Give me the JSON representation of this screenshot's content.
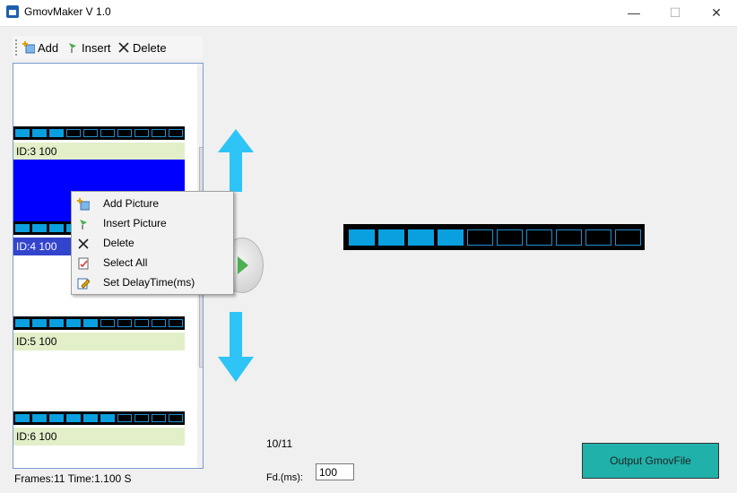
{
  "window": {
    "title": "GmovMaker V 1.0",
    "minimize_glyph": "—",
    "maximize_glyph": "☐",
    "close_glyph": "✕"
  },
  "toolbar": {
    "add_label": "Add",
    "insert_label": "Insert",
    "delete_label": "Delete"
  },
  "frames": [
    {
      "label": "ID:3  100",
      "cells": [
        1,
        1,
        1,
        0,
        0,
        0,
        0,
        0,
        0,
        0
      ],
      "selected": false
    },
    {
      "label": "ID:4  100",
      "cells": [
        1,
        1,
        1,
        1,
        0,
        0,
        0,
        0,
        0,
        0
      ],
      "selected": true
    },
    {
      "label": "ID:5  100",
      "cells": [
        1,
        1,
        1,
        1,
        1,
        0,
        0,
        0,
        0,
        0
      ],
      "selected": false
    },
    {
      "label": "ID:6  100",
      "cells": [
        1,
        1,
        1,
        1,
        1,
        1,
        0,
        0,
        0,
        0
      ],
      "selected": false
    }
  ],
  "context_menu": {
    "items": [
      {
        "label": "Add Picture",
        "icon": "add-picture-icon"
      },
      {
        "label": "Insert Picture",
        "icon": "insert-flag-icon"
      },
      {
        "label": "Delete",
        "icon": "delete-x-icon"
      },
      {
        "label": "Select All",
        "icon": "select-all-icon"
      },
      {
        "label": "Set DelayTime(ms)",
        "icon": "edit-icon"
      }
    ]
  },
  "preview": {
    "cells": [
      1,
      1,
      1,
      1,
      0,
      0,
      0,
      0,
      0,
      0
    ]
  },
  "status": {
    "frames_info": "Frames:11 Time:1.100 S",
    "page_counter": "10/11",
    "fd_label": "Fd.(ms):",
    "fd_value": "100"
  },
  "output_button": "Output GmovFile",
  "colors": {
    "cell_on": "#0aa0e0",
    "arrow": "#2ec4f5",
    "selection": "#3344cc",
    "label_bg": "#e2efc9",
    "output_button": "#20b2aa"
  }
}
